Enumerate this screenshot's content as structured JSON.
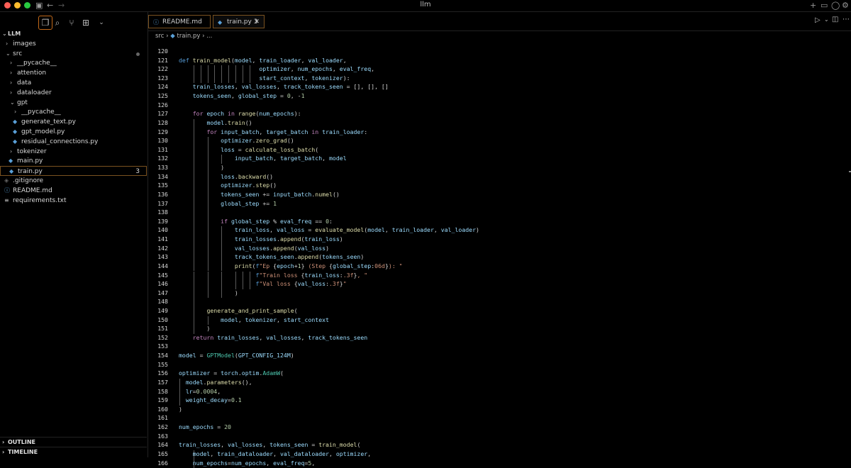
{
  "window": {
    "title": "llm",
    "traffic_colors": [
      "#fe5f57",
      "#febc2e",
      "#28c840"
    ]
  },
  "activity_icons": [
    "files-icon",
    "search-icon",
    "source-control-icon",
    "extensions-icon",
    "chevron-down-icon"
  ],
  "explorer": {
    "root": "LLM",
    "items": [
      {
        "label": "images",
        "kind": "folder",
        "open": false,
        "depth": 0
      },
      {
        "label": "src",
        "kind": "folder",
        "open": true,
        "depth": 0,
        "modified": true
      },
      {
        "label": "__pycache__",
        "kind": "folder",
        "open": false,
        "depth": 1
      },
      {
        "label": "attention",
        "kind": "folder",
        "open": false,
        "depth": 1
      },
      {
        "label": "data",
        "kind": "folder",
        "open": false,
        "depth": 1
      },
      {
        "label": "dataloader",
        "kind": "folder",
        "open": false,
        "depth": 1
      },
      {
        "label": "gpt",
        "kind": "folder",
        "open": true,
        "depth": 1
      },
      {
        "label": "__pycache__",
        "kind": "folder",
        "open": false,
        "depth": 2
      },
      {
        "label": "generate_text.py",
        "kind": "py",
        "depth": 2
      },
      {
        "label": "gpt_model.py",
        "kind": "py",
        "depth": 2
      },
      {
        "label": "residual_connections.py",
        "kind": "py",
        "depth": 2
      },
      {
        "label": "tokenizer",
        "kind": "folder",
        "open": false,
        "depth": 1
      },
      {
        "label": "main.py",
        "kind": "py",
        "depth": 1
      },
      {
        "label": "train.py",
        "kind": "py",
        "depth": 1,
        "badge": "3",
        "selected": true
      },
      {
        "label": ".gitignore",
        "kind": "git",
        "depth": 0
      },
      {
        "label": "README.md",
        "kind": "info",
        "depth": 0
      },
      {
        "label": "requirements.txt",
        "kind": "txt",
        "depth": 0
      }
    ],
    "outline_label": "OUTLINE",
    "timeline_label": "TIMELINE"
  },
  "tabs": [
    {
      "label": "README.md",
      "icon": "info-icon",
      "active": false
    },
    {
      "label": "train.py",
      "icon": "python-icon",
      "badge": "3",
      "active": true
    }
  ],
  "breadcrumb": {
    "folder": "src",
    "file": "train.py",
    "trail": "..."
  },
  "colors": {
    "keyword": "#569cd6",
    "control": "#c586c0",
    "func": "#dcdcaa",
    "var": "#9cdcfe",
    "class": "#4ec9b0",
    "string": "#ce9178",
    "number": "#b5cea8",
    "plain": "#d4d4d4",
    "accent": "#c46a1a"
  },
  "code": [
    {
      "n": "120",
      "g": 0,
      "t": [
        [
          "",
          ""
        ]
      ]
    },
    {
      "n": "121",
      "g": 0,
      "t": [
        [
          "k",
          "def "
        ],
        [
          "f",
          "train_model"
        ],
        [
          "p",
          "("
        ],
        [
          "v",
          "model"
        ],
        [
          "p",
          ", "
        ],
        [
          "v",
          "train_loader"
        ],
        [
          "p",
          ", "
        ],
        [
          "v",
          "val_loader"
        ],
        [
          "p",
          ","
        ]
      ]
    },
    {
      "n": "122",
      "g": 4,
      "t": [
        [
          "p",
          "                       "
        ],
        [
          "v",
          "optimizer"
        ],
        [
          "p",
          ", "
        ],
        [
          "v",
          "num_epochs"
        ],
        [
          "p",
          ", "
        ],
        [
          "v",
          "eval_freq"
        ],
        [
          "p",
          ","
        ]
      ]
    },
    {
      "n": "123",
      "g": 4,
      "t": [
        [
          "p",
          "                       "
        ],
        [
          "v",
          "start_context"
        ],
        [
          "p",
          ", "
        ],
        [
          "v",
          "tokenizer"
        ],
        [
          "p",
          "):"
        ]
      ]
    },
    {
      "n": "124",
      "g": 0,
      "t": [
        [
          "p",
          "    "
        ],
        [
          "v",
          "train_losses"
        ],
        [
          "p",
          ", "
        ],
        [
          "v",
          "val_losses"
        ],
        [
          "p",
          ", "
        ],
        [
          "v",
          "track_tokens_seen"
        ],
        [
          "p",
          " = [], [], []"
        ]
      ]
    },
    {
      "n": "125",
      "g": 0,
      "t": [
        [
          "p",
          "    "
        ],
        [
          "v",
          "tokens_seen"
        ],
        [
          "p",
          ", "
        ],
        [
          "v",
          "global_step"
        ],
        [
          "p",
          " = "
        ],
        [
          "n",
          "0"
        ],
        [
          "p",
          ", -"
        ],
        [
          "n",
          "1"
        ]
      ]
    },
    {
      "n": "126",
      "g": 0,
      "t": [
        [
          "p",
          ""
        ]
      ]
    },
    {
      "n": "127",
      "g": 0,
      "t": [
        [
          "p",
          "    "
        ],
        [
          "c",
          "for "
        ],
        [
          "v",
          "epoch"
        ],
        [
          "c",
          " in "
        ],
        [
          "f",
          "range"
        ],
        [
          "p",
          "("
        ],
        [
          "v",
          "num_epochs"
        ],
        [
          "p",
          "):"
        ]
      ]
    },
    {
      "n": "128",
      "g": 1,
      "t": [
        [
          "p",
          "        "
        ],
        [
          "v",
          "model"
        ],
        [
          "p",
          "."
        ],
        [
          "f",
          "train"
        ],
        [
          "p",
          "()"
        ]
      ]
    },
    {
      "n": "129",
      "g": 1,
      "t": [
        [
          "p",
          "        "
        ],
        [
          "c",
          "for "
        ],
        [
          "v",
          "input_batch"
        ],
        [
          "p",
          ", "
        ],
        [
          "v",
          "target_batch"
        ],
        [
          "c",
          " in "
        ],
        [
          "v",
          "train_loader"
        ],
        [
          "p",
          ":"
        ]
      ]
    },
    {
      "n": "130",
      "g": 2,
      "t": [
        [
          "p",
          "            "
        ],
        [
          "v",
          "optimizer"
        ],
        [
          "p",
          "."
        ],
        [
          "f",
          "zero_grad"
        ],
        [
          "p",
          "()"
        ]
      ]
    },
    {
      "n": "131",
      "g": 2,
      "t": [
        [
          "p",
          "            "
        ],
        [
          "v",
          "loss"
        ],
        [
          "p",
          " = "
        ],
        [
          "f",
          "calculate_loss_batch"
        ],
        [
          "p",
          "("
        ]
      ]
    },
    {
      "n": "132",
      "g": 3,
      "t": [
        [
          "p",
          "                "
        ],
        [
          "v",
          "input_batch"
        ],
        [
          "p",
          ", "
        ],
        [
          "v",
          "target_batch"
        ],
        [
          "p",
          ", "
        ],
        [
          "v",
          "model"
        ]
      ]
    },
    {
      "n": "133",
      "g": 2,
      "t": [
        [
          "p",
          "            )"
        ]
      ]
    },
    {
      "n": "134",
      "g": 2,
      "t": [
        [
          "p",
          "            "
        ],
        [
          "v",
          "loss"
        ],
        [
          "p",
          "."
        ],
        [
          "f",
          "backward"
        ],
        [
          "p",
          "()"
        ]
      ]
    },
    {
      "n": "135",
      "g": 2,
      "t": [
        [
          "p",
          "            "
        ],
        [
          "v",
          "optimizer"
        ],
        [
          "p",
          "."
        ],
        [
          "f",
          "step"
        ],
        [
          "p",
          "()"
        ]
      ]
    },
    {
      "n": "136",
      "g": 2,
      "t": [
        [
          "p",
          "            "
        ],
        [
          "v",
          "tokens_seen"
        ],
        [
          "p",
          " += "
        ],
        [
          "v",
          "input_batch"
        ],
        [
          "p",
          "."
        ],
        [
          "f",
          "numel"
        ],
        [
          "p",
          "()"
        ]
      ]
    },
    {
      "n": "137",
      "g": 2,
      "t": [
        [
          "p",
          "            "
        ],
        [
          "v",
          "global_step"
        ],
        [
          "p",
          " += "
        ],
        [
          "n",
          "1"
        ]
      ]
    },
    {
      "n": "138",
      "g": 2,
      "t": [
        [
          "p",
          ""
        ]
      ]
    },
    {
      "n": "139",
      "g": 2,
      "t": [
        [
          "p",
          "            "
        ],
        [
          "c",
          "if "
        ],
        [
          "v",
          "global_step"
        ],
        [
          "p",
          " % "
        ],
        [
          "v",
          "eval_freq"
        ],
        [
          "p",
          " == "
        ],
        [
          "n",
          "0"
        ],
        [
          "p",
          ":"
        ]
      ]
    },
    {
      "n": "140",
      "g": 3,
      "t": [
        [
          "p",
          "                "
        ],
        [
          "v",
          "train_loss"
        ],
        [
          "p",
          ", "
        ],
        [
          "v",
          "val_loss"
        ],
        [
          "p",
          " = "
        ],
        [
          "f",
          "evaluate_model"
        ],
        [
          "p",
          "("
        ],
        [
          "v",
          "model"
        ],
        [
          "p",
          ", "
        ],
        [
          "v",
          "train_loader"
        ],
        [
          "p",
          ", "
        ],
        [
          "v",
          "val_loader"
        ],
        [
          "p",
          ")"
        ]
      ]
    },
    {
      "n": "141",
      "g": 3,
      "t": [
        [
          "p",
          "                "
        ],
        [
          "v",
          "train_losses"
        ],
        [
          "p",
          "."
        ],
        [
          "f",
          "append"
        ],
        [
          "p",
          "("
        ],
        [
          "v",
          "train_loss"
        ],
        [
          "p",
          ")"
        ]
      ]
    },
    {
      "n": "142",
      "g": 3,
      "t": [
        [
          "p",
          "                "
        ],
        [
          "v",
          "val_losses"
        ],
        [
          "p",
          "."
        ],
        [
          "f",
          "append"
        ],
        [
          "p",
          "("
        ],
        [
          "v",
          "val_loss"
        ],
        [
          "p",
          ")"
        ]
      ]
    },
    {
      "n": "143",
      "g": 3,
      "t": [
        [
          "p",
          "                "
        ],
        [
          "v",
          "track_tokens_seen"
        ],
        [
          "p",
          "."
        ],
        [
          "f",
          "append"
        ],
        [
          "p",
          "("
        ],
        [
          "v",
          "tokens_seen"
        ],
        [
          "p",
          ")"
        ]
      ]
    },
    {
      "n": "144",
      "g": 3,
      "t": [
        [
          "p",
          "                "
        ],
        [
          "f",
          "print"
        ],
        [
          "p",
          "("
        ],
        [
          "k",
          "f"
        ],
        [
          "s",
          "\"Ep "
        ],
        [
          "p",
          "{"
        ],
        [
          "v",
          "epoch"
        ],
        [
          "p",
          "+"
        ],
        [
          "n",
          "1"
        ],
        [
          "p",
          "}"
        ],
        [
          "s",
          " (Step "
        ],
        [
          "p",
          "{"
        ],
        [
          "v",
          "global_step"
        ],
        [
          "p",
          ":"
        ],
        [
          "s",
          "06d"
        ],
        [
          "p",
          "}"
        ],
        [
          "s",
          "): \""
        ]
      ]
    },
    {
      "n": "145",
      "g": 5,
      "t": [
        [
          "p",
          "                      "
        ],
        [
          "k",
          "f"
        ],
        [
          "s",
          "\"Train loss "
        ],
        [
          "p",
          "{"
        ],
        [
          "v",
          "train_loss"
        ],
        [
          "p",
          ":"
        ],
        [
          "s",
          ".3f"
        ],
        [
          "p",
          "}"
        ],
        [
          "s",
          ", \""
        ]
      ]
    },
    {
      "n": "146",
      "g": 5,
      "t": [
        [
          "p",
          "                      "
        ],
        [
          "k",
          "f"
        ],
        [
          "s",
          "\"Val loss "
        ],
        [
          "p",
          "{"
        ],
        [
          "v",
          "val_loss"
        ],
        [
          "p",
          ":"
        ],
        [
          "s",
          ".3f"
        ],
        [
          "p",
          "}"
        ],
        [
          "s",
          "\""
        ]
      ]
    },
    {
      "n": "147",
      "g": 3,
      "t": [
        [
          "p",
          "                )"
        ]
      ]
    },
    {
      "n": "148",
      "g": 1,
      "t": [
        [
          "p",
          ""
        ]
      ]
    },
    {
      "n": "149",
      "g": 1,
      "t": [
        [
          "p",
          "        "
        ],
        [
          "f",
          "generate_and_print_sample"
        ],
        [
          "p",
          "("
        ]
      ]
    },
    {
      "n": "150",
      "g": 2,
      "t": [
        [
          "p",
          "            "
        ],
        [
          "v",
          "model"
        ],
        [
          "p",
          ", "
        ],
        [
          "v",
          "tokenizer"
        ],
        [
          "p",
          ", "
        ],
        [
          "v",
          "start_context"
        ]
      ]
    },
    {
      "n": "151",
      "g": 1,
      "t": [
        [
          "p",
          "        )"
        ]
      ]
    },
    {
      "n": "152",
      "g": 0,
      "t": [
        [
          "p",
          "    "
        ],
        [
          "c",
          "return "
        ],
        [
          "v",
          "train_losses"
        ],
        [
          "p",
          ", "
        ],
        [
          "v",
          "val_losses"
        ],
        [
          "p",
          ", "
        ],
        [
          "v",
          "track_tokens_seen"
        ]
      ]
    },
    {
      "n": "153",
      "g": 0,
      "t": [
        [
          "p",
          ""
        ]
      ]
    },
    {
      "n": "154",
      "g": 0,
      "t": [
        [
          "v",
          "model"
        ],
        [
          "p",
          " = "
        ],
        [
          "x",
          "GPTModel"
        ],
        [
          "p",
          "("
        ],
        [
          "v",
          "GPT_CONFIG_124M"
        ],
        [
          "p",
          ")"
        ]
      ]
    },
    {
      "n": "155",
      "g": 0,
      "t": [
        [
          "p",
          ""
        ]
      ]
    },
    {
      "n": "156",
      "g": 0,
      "t": [
        [
          "v",
          "optimizer"
        ],
        [
          "p",
          " = "
        ],
        [
          "v",
          "torch"
        ],
        [
          "p",
          "."
        ],
        [
          "v",
          "optim"
        ],
        [
          "p",
          "."
        ],
        [
          "x",
          "AdamW"
        ],
        [
          "p",
          "("
        ]
      ]
    },
    {
      "n": "157",
      "g": 6,
      "t": [
        [
          "p",
          "  "
        ],
        [
          "v",
          "model"
        ],
        [
          "p",
          "."
        ],
        [
          "f",
          "parameters"
        ],
        [
          "p",
          "(),"
        ]
      ]
    },
    {
      "n": "158",
      "g": 6,
      "t": [
        [
          "p",
          "  "
        ],
        [
          "v",
          "lr"
        ],
        [
          "p",
          "="
        ],
        [
          "n",
          "0.0004"
        ],
        [
          "p",
          ","
        ]
      ]
    },
    {
      "n": "159",
      "g": 6,
      "t": [
        [
          "p",
          "  "
        ],
        [
          "v",
          "weight_decay"
        ],
        [
          "p",
          "="
        ],
        [
          "n",
          "0.1"
        ]
      ]
    },
    {
      "n": "160",
      "g": 0,
      "t": [
        [
          "p",
          ")"
        ]
      ]
    },
    {
      "n": "161",
      "g": 0,
      "t": [
        [
          "p",
          ""
        ]
      ]
    },
    {
      "n": "162",
      "g": 0,
      "t": [
        [
          "v",
          "num_epochs"
        ],
        [
          "p",
          " = "
        ],
        [
          "n",
          "20"
        ]
      ]
    },
    {
      "n": "163",
      "g": 0,
      "t": [
        [
          "p",
          ""
        ]
      ]
    },
    {
      "n": "164",
      "g": 0,
      "t": [
        [
          "v",
          "train_losses"
        ],
        [
          "p",
          ", "
        ],
        [
          "v",
          "val_losses"
        ],
        [
          "p",
          ", "
        ],
        [
          "v",
          "tokens_seen"
        ],
        [
          "p",
          " = "
        ],
        [
          "f",
          "train_model"
        ],
        [
          "p",
          "("
        ]
      ]
    },
    {
      "n": "165",
      "g": 1,
      "t": [
        [
          "p",
          "    "
        ],
        [
          "v",
          "model"
        ],
        [
          "p",
          ", "
        ],
        [
          "v",
          "train_dataloader"
        ],
        [
          "p",
          ", "
        ],
        [
          "v",
          "val_dataloader"
        ],
        [
          "p",
          ", "
        ],
        [
          "v",
          "optimizer"
        ],
        [
          "p",
          ","
        ]
      ]
    },
    {
      "n": "166",
      "g": 1,
      "t": [
        [
          "p",
          "    "
        ],
        [
          "v",
          "num_epochs"
        ],
        [
          "p",
          "="
        ],
        [
          "v",
          "num_epochs"
        ],
        [
          "p",
          ", "
        ],
        [
          "v",
          "eval_freq"
        ],
        [
          "p",
          "="
        ],
        [
          "n",
          "5"
        ],
        [
          "p",
          ","
        ]
      ]
    }
  ]
}
